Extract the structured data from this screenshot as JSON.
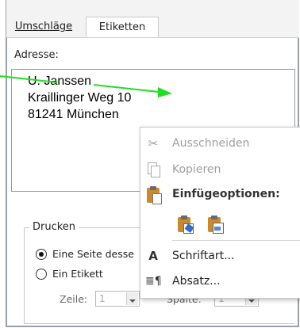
{
  "tabs": [
    {
      "label": "Umschläge",
      "active": false
    },
    {
      "label": "Etiketten",
      "active": true
    }
  ],
  "address": {
    "label": "Adresse:",
    "lines": [
      "U. Janssen",
      "Kraillinger Weg 10",
      "81241 München"
    ]
  },
  "print": {
    "group_label": "Drucken",
    "option_full_page": "Eine Seite desse",
    "option_single_label": "Ein Etikett",
    "row_label": "Zeile:",
    "row_value": "1",
    "column_label": "Spalte:",
    "column_value": "1"
  },
  "context_menu": {
    "cut": "Ausschneiden",
    "copy": "Kopieren",
    "paste_options": "Einfügeoptionen:",
    "font": "Schriftart...",
    "paragraph": "Absatz..."
  },
  "colors": {
    "arrow": "#22dd22",
    "menu_border": "#c9c9c9"
  }
}
